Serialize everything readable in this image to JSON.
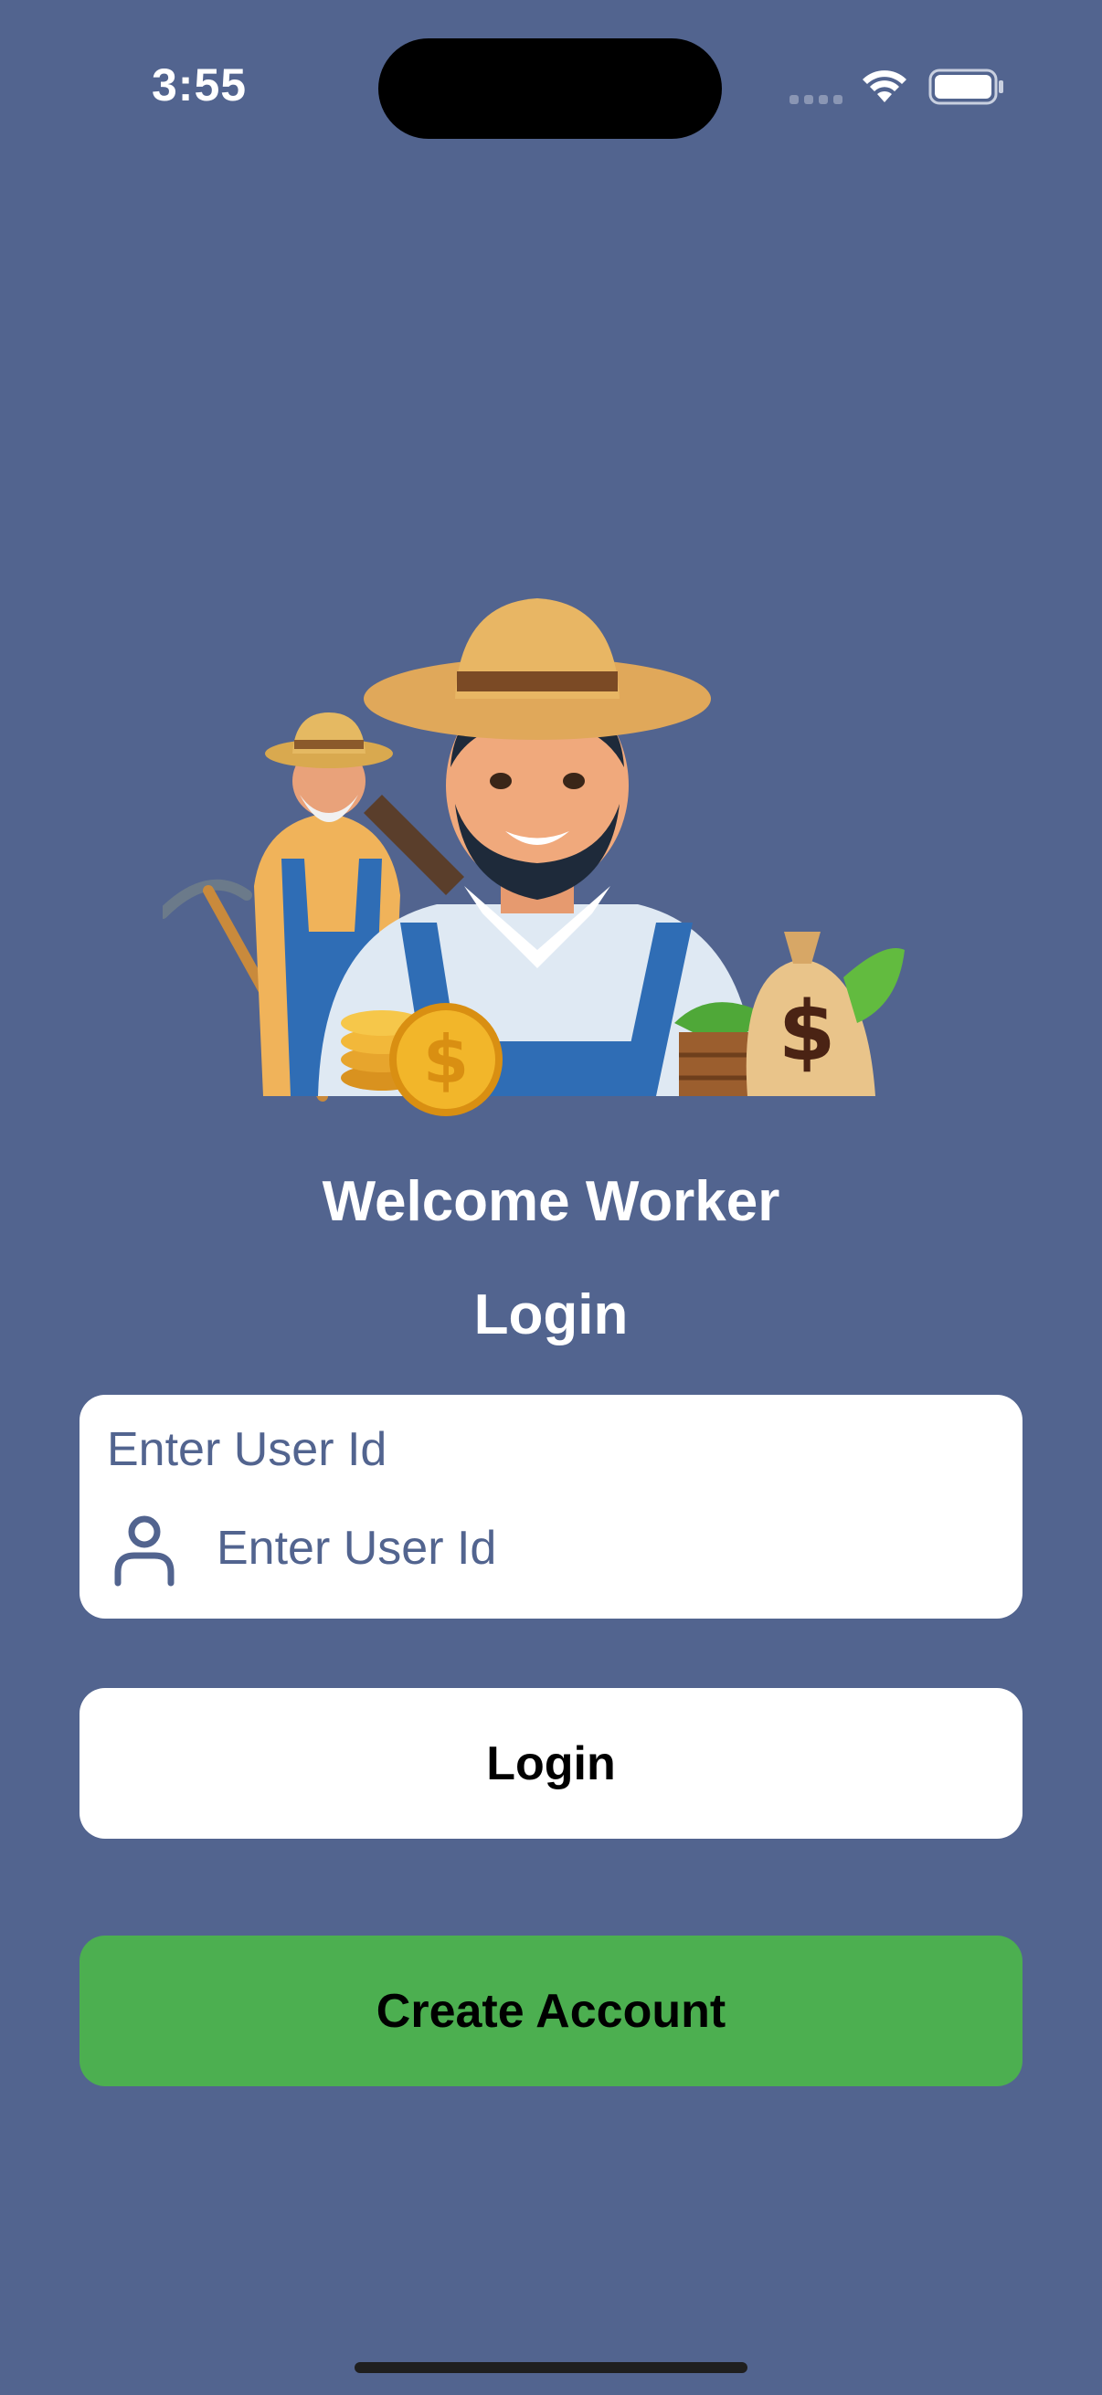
{
  "status_bar": {
    "time": "3:55"
  },
  "welcome_title": "Welcome Worker",
  "login_heading": "Login",
  "user_id": {
    "label": "Enter User Id",
    "placeholder": "Enter User Id",
    "value": ""
  },
  "buttons": {
    "login_label": "Login",
    "create_account_label": "Create Account"
  },
  "icons": {
    "wifi": "wifi-icon",
    "battery": "battery-icon",
    "user": "user-icon"
  },
  "colors": {
    "background": "#52648f",
    "create_account": "#4caf50",
    "card": "#ffffff"
  }
}
